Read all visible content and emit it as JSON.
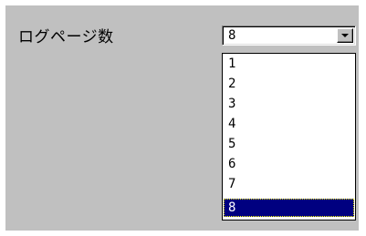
{
  "field": {
    "label": "ログページ数"
  },
  "combobox": {
    "selected_value": "8",
    "button_icon": "chevron-down-icon"
  },
  "dropdown": {
    "options": [
      "1",
      "2",
      "3",
      "4",
      "5",
      "6",
      "7",
      "8"
    ],
    "selected_index": 7
  },
  "colors": {
    "panel_background": "#c0c0c0",
    "selection_background": "#000080",
    "selection_text": "#ffffff"
  }
}
